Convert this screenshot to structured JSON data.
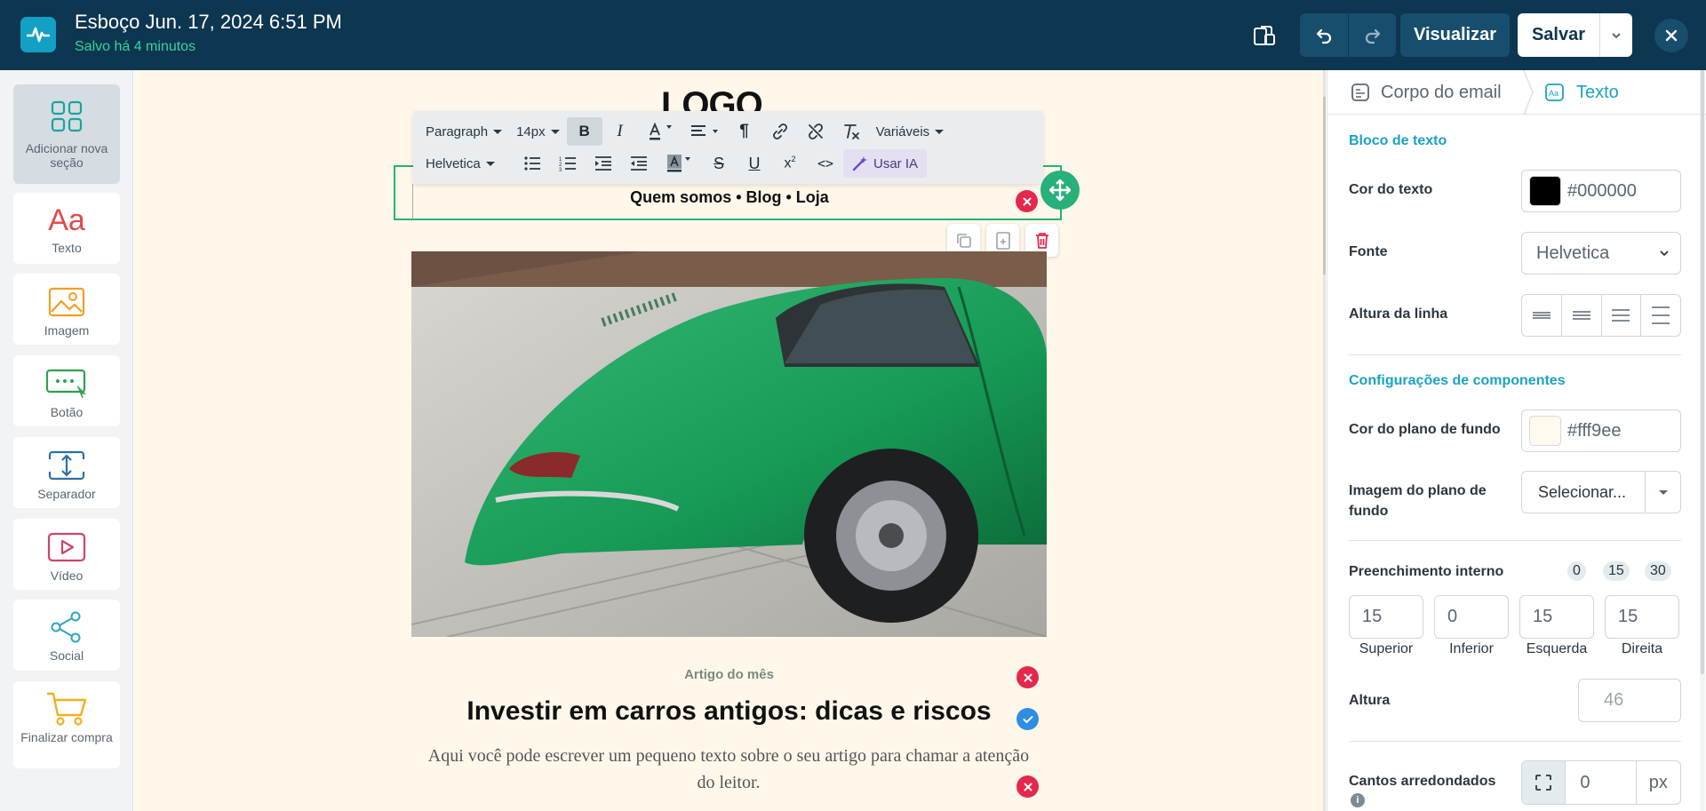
{
  "header": {
    "title": "Esboço Jun. 17, 2024 6:51 PM",
    "status": "Salvo há 4 minutos",
    "preview_label": "Visualizar",
    "save_label": "Salvar"
  },
  "sidebar": {
    "items": [
      {
        "label": "Adicionar nova seção",
        "icon": "grid-icon"
      },
      {
        "label": "Texto",
        "icon": "text-aa-icon"
      },
      {
        "label": "Imagem",
        "icon": "image-icon"
      },
      {
        "label": "Botão",
        "icon": "button-icon"
      },
      {
        "label": "Separador",
        "icon": "separator-icon"
      },
      {
        "label": "Vídeo",
        "icon": "video-icon"
      },
      {
        "label": "Social",
        "icon": "share-icon"
      },
      {
        "label": "Finalizar compra",
        "icon": "cart-icon"
      }
    ]
  },
  "canvas": {
    "logo": "LOGO",
    "nav_links": "Quem somos • Blog • Loja",
    "article_kicker": "Artigo do mês",
    "article_title": "Investir em carros antigos: dicas e riscos",
    "article_body": "Aqui você pode escrever um pequeno texto sobre o seu artigo para chamar a atenção do leitor."
  },
  "toolbar": {
    "format": "Paragraph",
    "size": "14px",
    "font": "Helvetica",
    "variables": "Variáveis",
    "ai": "Usar IA"
  },
  "panel": {
    "tab_body": "Corpo do email",
    "tab_text": "Texto",
    "text_block_title": "Bloco de texto",
    "text_color_label": "Cor do texto",
    "text_color_value": "#000000",
    "font_label": "Fonte",
    "font_value": "Helvetica",
    "line_height_label": "Altura da linha",
    "components_title": "Configurações de componentes",
    "bg_color_label": "Cor do plano de fundo",
    "bg_color_value": "#fff9ee",
    "bg_image_label": "Imagem do plano de fundo",
    "bg_image_value": "Selecionar...",
    "padding_label": "Preenchimento interno",
    "padding_presets": [
      "0",
      "15",
      "30"
    ],
    "padding": [
      {
        "value": "15",
        "label": "Superior"
      },
      {
        "value": "0",
        "label": "Inferior"
      },
      {
        "value": "15",
        "label": "Esquerda"
      },
      {
        "value": "15",
        "label": "Direita"
      }
    ],
    "height_label": "Altura",
    "height_value": "46",
    "radius_label": "Cantos arredondados",
    "radius_value": "0",
    "radius_unit": "px"
  },
  "colors": {
    "topbar": "#0d3650",
    "accent_green": "#27b07a",
    "accent_teal": "#1aa3c4",
    "danger": "#e5274c",
    "canvas_bg": "#fff8ea"
  }
}
